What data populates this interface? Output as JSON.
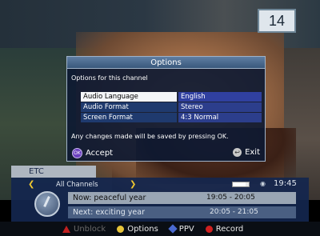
{
  "channel_number": "14",
  "dialog": {
    "title": "Options",
    "subtitle": "Options for this channel",
    "rows": [
      {
        "label": "Audio Language",
        "value": "English"
      },
      {
        "label": "Audio Format",
        "value": "Stereo"
      },
      {
        "label": "Screen Format",
        "value": "4:3 Normal"
      }
    ],
    "note": "Any changes made will be saved by pressing OK.",
    "ok_badge": "OK",
    "accept_label": "Accept",
    "exit_label": "Exit"
  },
  "banner": {
    "etc_label": "ETC",
    "channel_list": "All Channels",
    "clock": "19:45",
    "now": {
      "label": "Now: peaceful year",
      "time": "19:05 - 20:05"
    },
    "next": {
      "label": "Next: exciting year",
      "time": "20:05 - 21:05"
    }
  },
  "legend": {
    "items": [
      {
        "label": "Unblock",
        "color": "#c02020",
        "icon": "red-triangle-icon",
        "dimmed": true
      },
      {
        "label": "Options",
        "color": "#e6c43a",
        "icon": "yellow-circle-icon",
        "dimmed": false
      },
      {
        "label": "PPV",
        "color": "#4a6ad0",
        "icon": "blue-diamond-icon",
        "dimmed": false
      },
      {
        "label": "Record",
        "color": "#d02020",
        "icon": "red-circle-icon",
        "dimmed": false
      }
    ]
  }
}
